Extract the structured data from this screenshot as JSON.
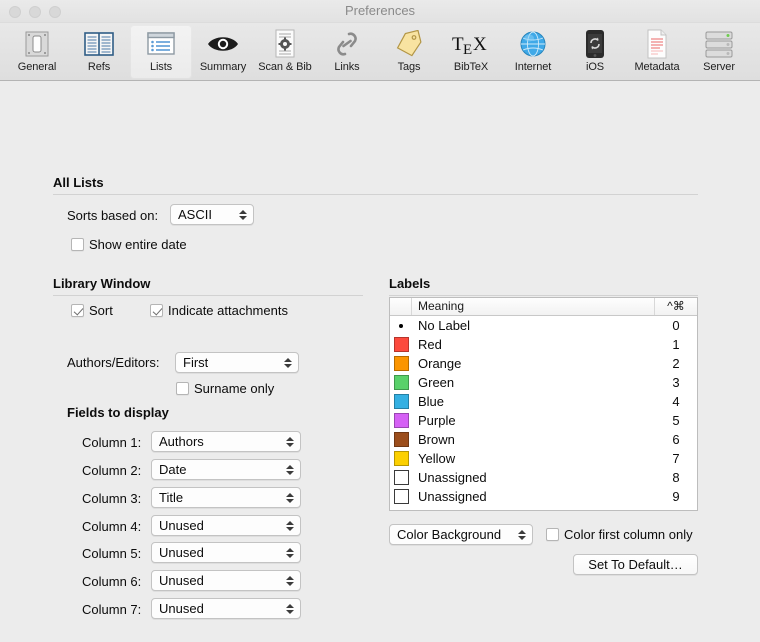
{
  "window": {
    "title": "Preferences",
    "traffic_lights": [
      "close",
      "minimize",
      "zoom"
    ]
  },
  "toolbar": {
    "selected": "Lists",
    "items": [
      {
        "label": "General",
        "icon": "general-switch-icon"
      },
      {
        "label": "Refs",
        "icon": "open-book-icon"
      },
      {
        "label": "Lists",
        "icon": "list-rows-icon"
      },
      {
        "label": "Summary",
        "icon": "eye-icon"
      },
      {
        "label": "Scan & Bib",
        "icon": "document-gear-icon"
      },
      {
        "label": "Links",
        "icon": "chain-link-icon"
      },
      {
        "label": "Tags",
        "icon": "tag-icon"
      },
      {
        "label": "BibTeX",
        "icon": "tex-logo-icon"
      },
      {
        "label": "Internet",
        "icon": "globe-icon"
      },
      {
        "label": "iOS",
        "icon": "iphone-sync-icon"
      },
      {
        "label": "Metadata",
        "icon": "document-lines-icon"
      },
      {
        "label": "Server",
        "icon": "server-stack-icon"
      }
    ]
  },
  "all_lists": {
    "title": "All Lists",
    "sorts_label": "Sorts based on:",
    "sorts_value": "ASCII",
    "show_entire_date": {
      "label": "Show entire date",
      "checked": false
    }
  },
  "library_window": {
    "title": "Library Window",
    "sort": {
      "label": "Sort",
      "checked": true
    },
    "indicate_attachments": {
      "label": "Indicate attachments",
      "checked": true
    },
    "authors_editors_label": "Authors/Editors:",
    "authors_editors_value": "First",
    "surname_only": {
      "label": "Surname only",
      "checked": false
    }
  },
  "fields_to_display": {
    "title": "Fields to display",
    "columns": [
      {
        "label": "Column 1:",
        "value": "Authors"
      },
      {
        "label": "Column 2:",
        "value": "Date"
      },
      {
        "label": "Column 3:",
        "value": "Title"
      },
      {
        "label": "Column 4:",
        "value": "Unused"
      },
      {
        "label": "Column 5:",
        "value": "Unused"
      },
      {
        "label": "Column 6:",
        "value": "Unused"
      },
      {
        "label": "Column 7:",
        "value": "Unused"
      }
    ]
  },
  "labels": {
    "title": "Labels",
    "columns": {
      "swatch": "",
      "meaning": "Meaning",
      "key": "^⌘"
    },
    "rows": [
      {
        "meaning": "No Label",
        "key": "0",
        "color": "none",
        "style": "dot"
      },
      {
        "meaning": "Red",
        "key": "1",
        "color": "#fc4a3d",
        "style": "fill"
      },
      {
        "meaning": "Orange",
        "key": "2",
        "color": "#fb9500",
        "style": "fill"
      },
      {
        "meaning": "Green",
        "key": "3",
        "color": "#59d16a",
        "style": "fill"
      },
      {
        "meaning": "Blue",
        "key": "4",
        "color": "#34b0e2",
        "style": "fill"
      },
      {
        "meaning": "Purple",
        "key": "5",
        "color": "#d561f5",
        "style": "fill"
      },
      {
        "meaning": "Brown",
        "key": "6",
        "color": "#9c4e1c",
        "style": "fill"
      },
      {
        "meaning": "Yellow",
        "key": "7",
        "color": "#fcd000",
        "style": "fill"
      },
      {
        "meaning": "Unassigned",
        "key": "8",
        "color": "#ffffff",
        "style": "empty"
      },
      {
        "meaning": "Unassigned",
        "key": "9",
        "color": "#ffffff",
        "style": "empty"
      }
    ],
    "color_mode_value": "Color Background",
    "color_first_column_only": {
      "label": "Color first column only",
      "checked": false
    },
    "set_to_default_label": "Set To Default…"
  }
}
